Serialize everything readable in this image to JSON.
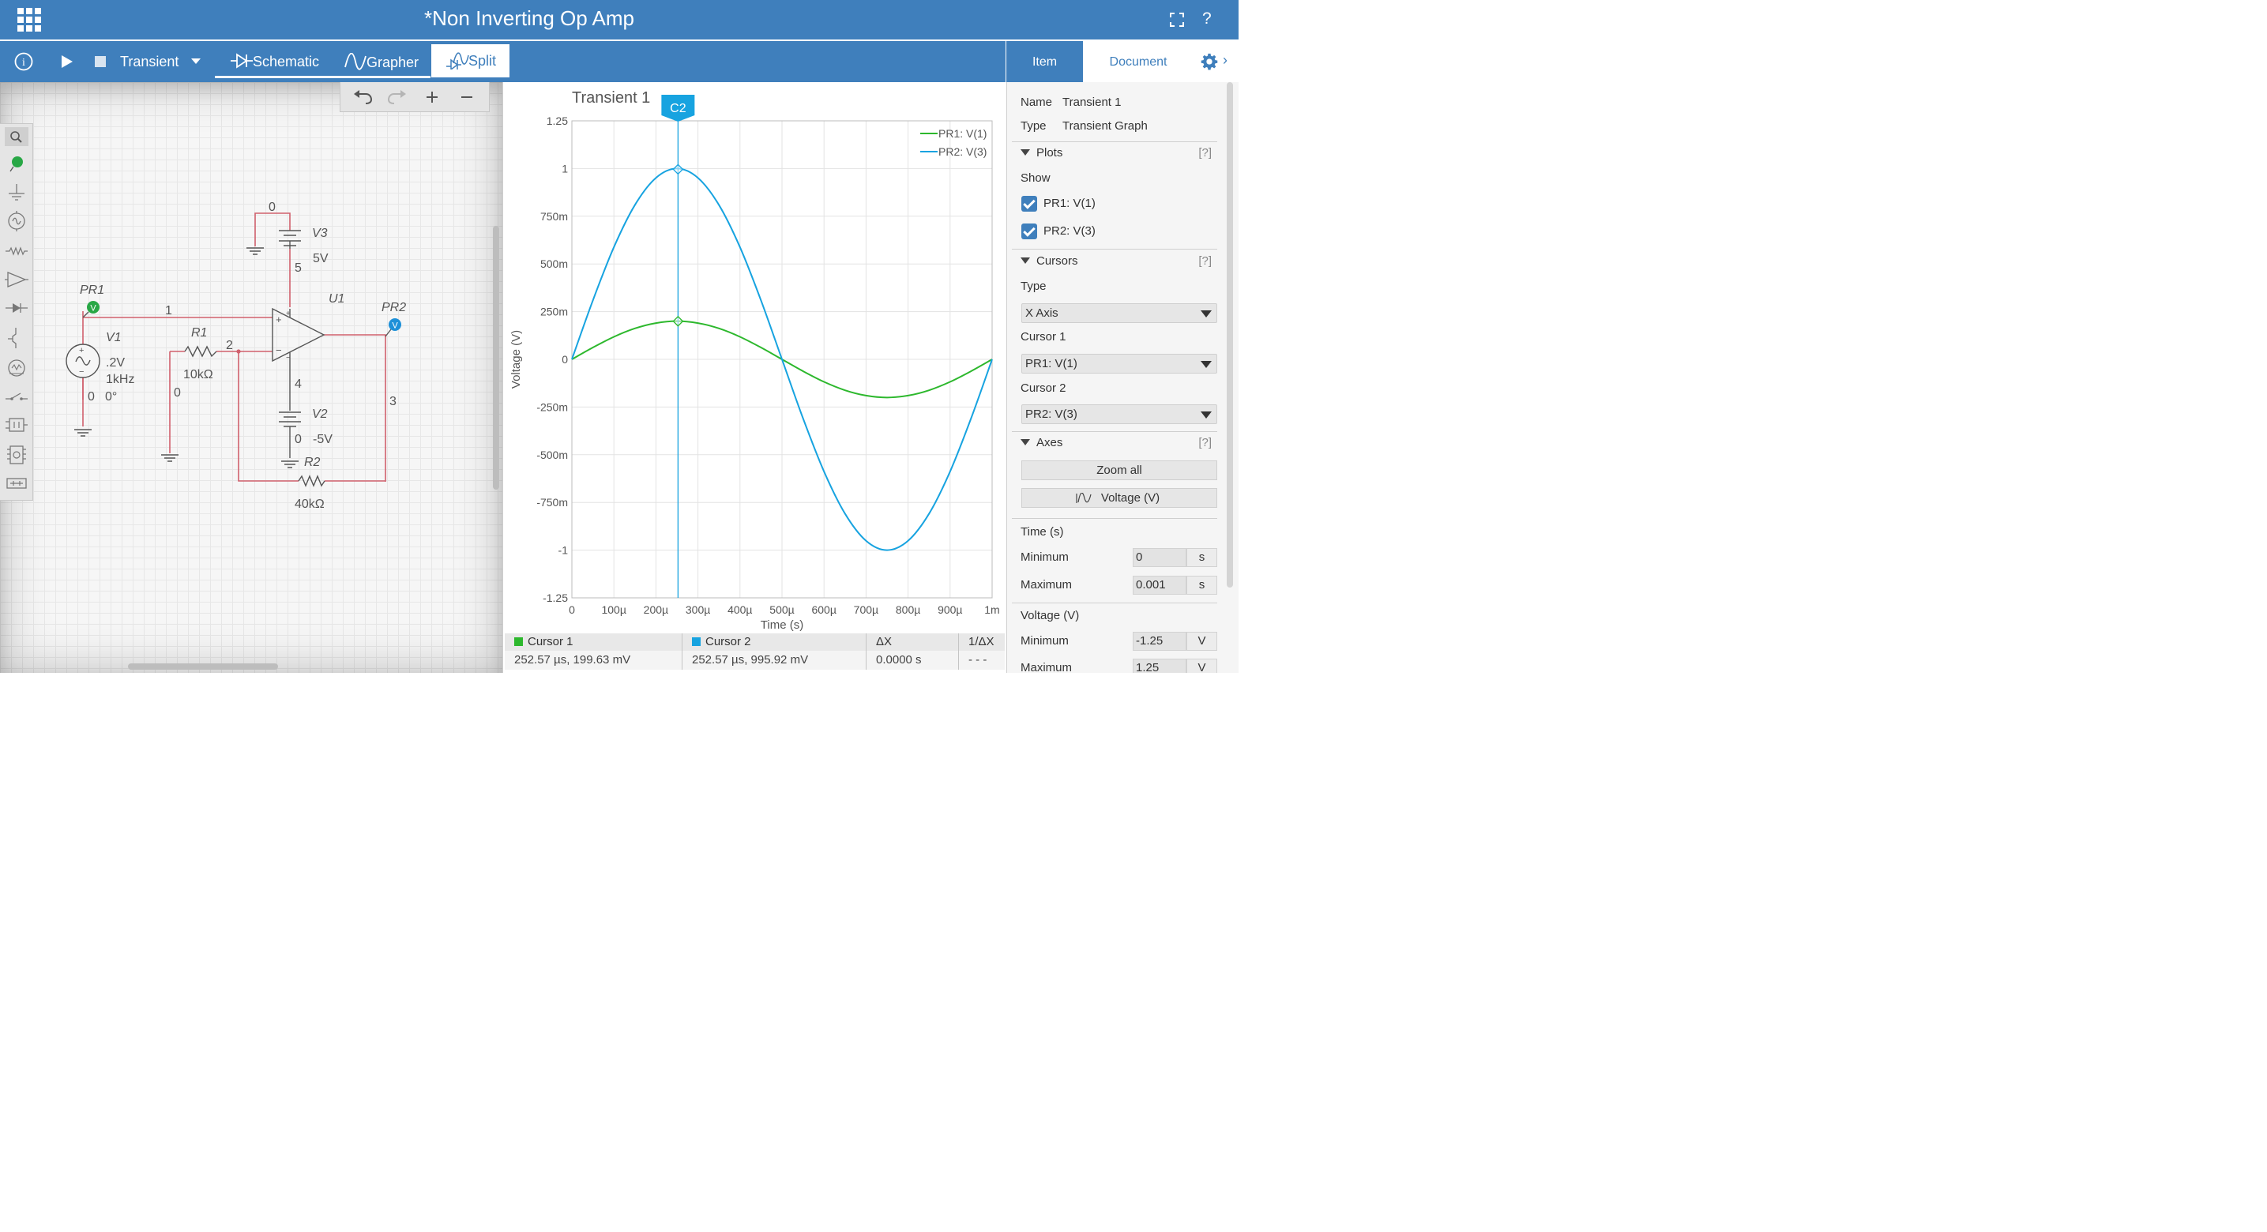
{
  "app": {
    "title": "*Non Inverting Op Amp",
    "help_label": "?"
  },
  "toolbar": {
    "info_label": "i",
    "analysis_label": "Transient",
    "tabs": [
      "Schematic",
      "Grapher",
      "Split"
    ],
    "active_tab": "Split"
  },
  "right_panel": {
    "tabs": [
      "Item",
      "Document"
    ],
    "active_tab": "Item",
    "name_label": "Name",
    "name_value": "Transient 1",
    "type_label": "Type",
    "type_value": "Transient Graph",
    "help_hint": "[?]",
    "plots": {
      "title": "Plots",
      "show_label": "Show",
      "items": [
        {
          "label": "PR1: V(1)",
          "checked": true
        },
        {
          "label": "PR2: V(3)",
          "checked": true
        }
      ]
    },
    "cursors": {
      "title": "Cursors",
      "type_label": "Type",
      "type_value": "X Axis",
      "cursor1_label": "Cursor 1",
      "cursor1_value": "PR1: V(1)",
      "cursor2_label": "Cursor 2",
      "cursor2_value": "PR2: V(3)"
    },
    "axes": {
      "title": "Axes",
      "zoom_all_label": "Zoom all",
      "voltage_button_label": "Voltage (V)",
      "time_label": "Time (s)",
      "time_min_label": "Minimum",
      "time_min_value": "0",
      "time_min_unit": "s",
      "time_max_label": "Maximum",
      "time_max_value": "0.001",
      "time_max_unit": "s",
      "voltage_label": "Voltage (V)",
      "volt_min_label": "Minimum",
      "volt_min_value": "-1.25",
      "volt_min_unit": "V",
      "volt_max_label": "Maximum",
      "volt_max_value": "1.25",
      "volt_max_unit": "V"
    }
  },
  "schematic": {
    "labels": {
      "node0_top": "0",
      "v3_name": "V3",
      "v3_value": "5V",
      "node5": "5",
      "u1_name": "U1",
      "pr1_name": "PR1",
      "pr2_name": "PR2",
      "node1": "1",
      "v1_name": "V1",
      "v1_amp": ".2V",
      "v1_freq": "1kHz",
      "v1_zero": "0",
      "v1_phase": "0°",
      "r1_name": "R1",
      "r1_value": "10kΩ",
      "node2": "2",
      "node0_mid": "0",
      "node4": "4",
      "node3": "3",
      "v2_name": "V2",
      "v2_zero": "0",
      "v2_value": "-5V",
      "r2_name": "R2",
      "r2_value": "40kΩ",
      "probe_glyph": "V"
    }
  },
  "cursor_table": {
    "cursor1_label": "Cursor 1",
    "cursor1_value": "252.57 µs, 199.63 mV",
    "cursor2_label": "Cursor 2",
    "cursor2_value": "252.57 µs, 995.92 mV",
    "dx_label": "ΔX",
    "dx_value": "0.0000 s",
    "inv_dx_label": "1/ΔX",
    "inv_dx_value": "- - -"
  },
  "colors": {
    "brand": "#3f7fbc",
    "series1": "#2db82d",
    "series2": "#17a3e0",
    "wire": "#d0606d"
  },
  "chart_data": {
    "type": "line",
    "title": "Transient 1",
    "xlabel": "Time (s)",
    "ylabel": "Voltage (V)",
    "xlim": [
      0,
      0.001
    ],
    "ylim": [
      -1.25,
      1.25
    ],
    "x_ticks": [
      "0",
      "100µ",
      "200µ",
      "300µ",
      "400µ",
      "500µ",
      "600µ",
      "700µ",
      "800µ",
      "900µ",
      "1m"
    ],
    "y_ticks": [
      "1.25",
      "1",
      "750m",
      "500m",
      "250m",
      "0",
      "-250m",
      "-500m",
      "-750m",
      "-1",
      "-1.25"
    ],
    "grid": true,
    "legend_position": "top-right",
    "cursor": {
      "label": "C2",
      "x": 0.00025257
    },
    "x": [
      0,
      5e-05,
      0.0001,
      0.00015,
      0.0002,
      0.00025,
      0.0003,
      0.00035,
      0.0004,
      0.00045,
      0.0005,
      0.00055,
      0.0006,
      0.00065,
      0.0007,
      0.00075,
      0.0008,
      0.00085,
      0.0009,
      0.00095,
      0.001
    ],
    "series": [
      {
        "name": "PR1: V(1)",
        "color": "#2db82d",
        "values": [
          0,
          0.062,
          0.118,
          0.162,
          0.19,
          0.2,
          0.19,
          0.162,
          0.118,
          0.062,
          0,
          -0.062,
          -0.118,
          -0.162,
          -0.19,
          -0.2,
          -0.19,
          -0.162,
          -0.118,
          -0.062,
          0
        ]
      },
      {
        "name": "PR2: V(3)",
        "color": "#17a3e0",
        "values": [
          0,
          0.309,
          0.588,
          0.809,
          0.951,
          1.0,
          0.951,
          0.809,
          0.588,
          0.309,
          0,
          -0.309,
          -0.588,
          -0.809,
          -0.951,
          -1.0,
          -0.951,
          -0.809,
          -0.588,
          -0.309,
          0
        ]
      }
    ],
    "markers": [
      {
        "series": "PR1: V(1)",
        "x": 0.00025257,
        "y": 0.19963
      },
      {
        "series": "PR2: V(3)",
        "x": 0.00025257,
        "y": 0.99592
      }
    ]
  }
}
